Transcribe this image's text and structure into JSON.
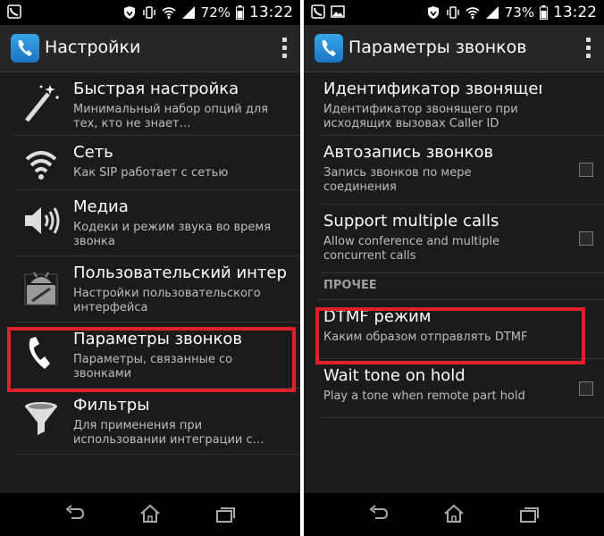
{
  "left": {
    "status": {
      "battery": "72%",
      "time": "13:22"
    },
    "title": "Настройки",
    "items": [
      {
        "title": "Быстрая настройка",
        "summary": "Минимальный набор опций для тех, кто не знает…",
        "icon": "magic-wand-icon"
      },
      {
        "title": "Сеть",
        "summary": "Как SIP работает с сетью",
        "icon": "wifi-icon"
      },
      {
        "title": "Медиа",
        "summary": "Кодеки и режим звука во время звонка",
        "icon": "speaker-icon"
      },
      {
        "title": "Пользовательский интер",
        "summary": "Настройки пользовательского интерфейса",
        "icon": "android-ui-icon"
      },
      {
        "title": "Параметры звонков",
        "summary": "Параметры, связанные со звонками",
        "icon": "phone-icon"
      },
      {
        "title": "Фильтры",
        "summary": "Для применения при использовании интеграции с…",
        "icon": "filter-icon"
      }
    ]
  },
  "right": {
    "status": {
      "battery": "73%",
      "time": "13:22"
    },
    "title": "Параметры звонков",
    "items": [
      {
        "title": "Идентификатор звонящего",
        "summary": "Идентификатор звонящего при исходящих вызовах Caller ID"
      },
      {
        "title": "Автозапись звонков",
        "summary": "Запись звонков по мере соединения"
      },
      {
        "title": "Support multiple calls",
        "summary": "Allow conference and multiple concurrent calls"
      }
    ],
    "section": "ПРОЧЕЕ",
    "items2": [
      {
        "title": "DTMF режим",
        "summary": "Каким образом отправлять DTMF"
      },
      {
        "title": "Wait tone on hold",
        "summary": "Play a tone when remote part hold"
      }
    ]
  },
  "colors": {
    "highlight": "#e0202a",
    "background": "#1b1b1b",
    "accent": "#1a73c5"
  }
}
